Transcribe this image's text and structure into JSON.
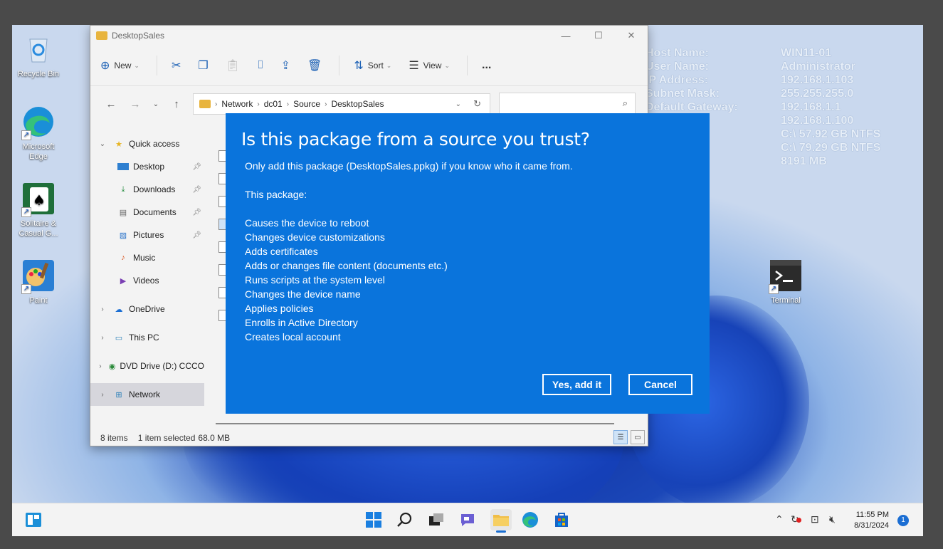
{
  "desktop": {
    "icons": [
      {
        "label": "Recycle Bin"
      },
      {
        "label": "Microsoft Edge"
      },
      {
        "label": "Solitaire & Casual G..."
      },
      {
        "label": "Paint"
      },
      {
        "label": "Terminal"
      }
    ]
  },
  "bginfo": {
    "rows": [
      {
        "key": "Host Name:",
        "value": "WIN11-01"
      },
      {
        "key": "User Name:",
        "value": "Administrator"
      },
      {
        "key": "IP Address:",
        "value": "192.168.1.103"
      },
      {
        "key": "Subnet Mask:",
        "value": "255.255.255.0"
      },
      {
        "key": "Default Gateway:",
        "value": "192.168.1.1"
      },
      {
        "key": "",
        "value": "192.168.1.100"
      },
      {
        "key": "",
        "value": "C:\\ 57.92 GB NTFS"
      },
      {
        "key": "",
        "value": "C:\\ 79.29 GB NTFS"
      },
      {
        "key": "",
        "value": "8191 MB"
      }
    ]
  },
  "explorer": {
    "title": "DesktopSales",
    "toolbar": {
      "new": "New",
      "sort": "Sort",
      "view": "View",
      "more": "..."
    },
    "address": {
      "crumbs": [
        "Network",
        "dc01",
        "Source",
        "DesktopSales"
      ]
    },
    "nav": {
      "quick_access": "Quick access",
      "items": [
        {
          "label": "Desktop"
        },
        {
          "label": "Downloads"
        },
        {
          "label": "Documents"
        },
        {
          "label": "Pictures"
        },
        {
          "label": "Music"
        },
        {
          "label": "Videos"
        }
      ],
      "onedrive": "OneDrive",
      "this_pc": "This PC",
      "dvd": "DVD Drive (D:) CCCO",
      "network": "Network"
    },
    "status": {
      "items": "8 items",
      "selected": "1 item selected",
      "size": "68.0 MB"
    }
  },
  "dialog": {
    "title": "Is this package from a source you trust?",
    "intro": "Only add this package (DesktopSales.ppkg) if you know who it came from.",
    "package_label": "This package:",
    "items": [
      "Causes the device to reboot",
      "Changes device customizations",
      "Adds certificates",
      "Adds or changes file content (documents etc.)",
      "Runs scripts at the system level",
      "Changes the device name",
      "Applies policies",
      "Enrolls in Active Directory",
      "Creates local account"
    ],
    "yes_label": "Yes, add it",
    "cancel_label": "Cancel"
  },
  "taskbar": {
    "time": "11:55 PM",
    "date": "8/31/2024",
    "notifications": "1"
  }
}
